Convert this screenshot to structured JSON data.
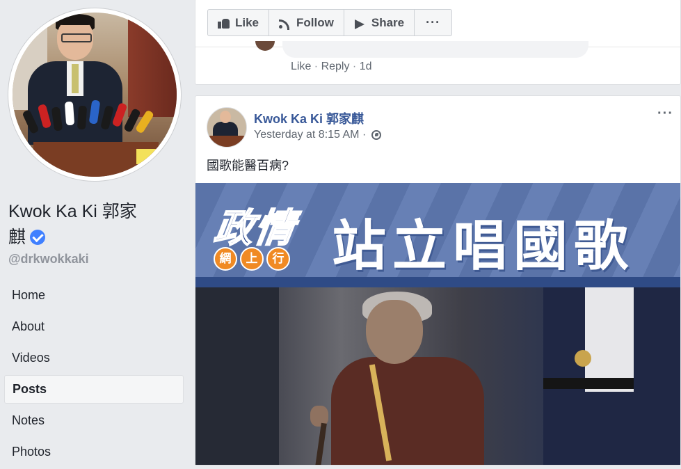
{
  "sidebar": {
    "page_name_line1": "Kwok Ka Ki 郭家",
    "page_name_line2": "麒",
    "handle": "@drkwokkaki",
    "nav": [
      {
        "label": "Home",
        "active": false
      },
      {
        "label": "About",
        "active": false
      },
      {
        "label": "Videos",
        "active": false
      },
      {
        "label": "Posts",
        "active": true
      },
      {
        "label": "Notes",
        "active": false
      },
      {
        "label": "Photos",
        "active": false
      }
    ]
  },
  "top_card": {
    "actions": {
      "like": "Like",
      "follow": "Follow",
      "share": "Share",
      "more": "···"
    },
    "comment_meta": {
      "like": "Like",
      "reply": "Reply",
      "age": "1d",
      "separator": " · "
    }
  },
  "post": {
    "author": "Kwok Ka Ki 郭家麒",
    "time": "Yesterday at 8:15 AM ·",
    "menu": "···",
    "text": "國歌能醫百病?",
    "image": {
      "show_title": "政情",
      "show_sub": [
        "網",
        "上",
        "行"
      ],
      "headline": "站立唱國歌"
    }
  },
  "colors": {
    "link_blue": "#385898",
    "page_bg": "#e9ebee",
    "verified_blue": "#4080ff",
    "banner_blue": "#5a73a8"
  },
  "icons": {
    "verified": "verified-badge-icon",
    "like": "thumbs-up-icon",
    "follow": "rss-follow-icon",
    "share": "share-arrow-icon",
    "privacy": "globe-icon"
  }
}
